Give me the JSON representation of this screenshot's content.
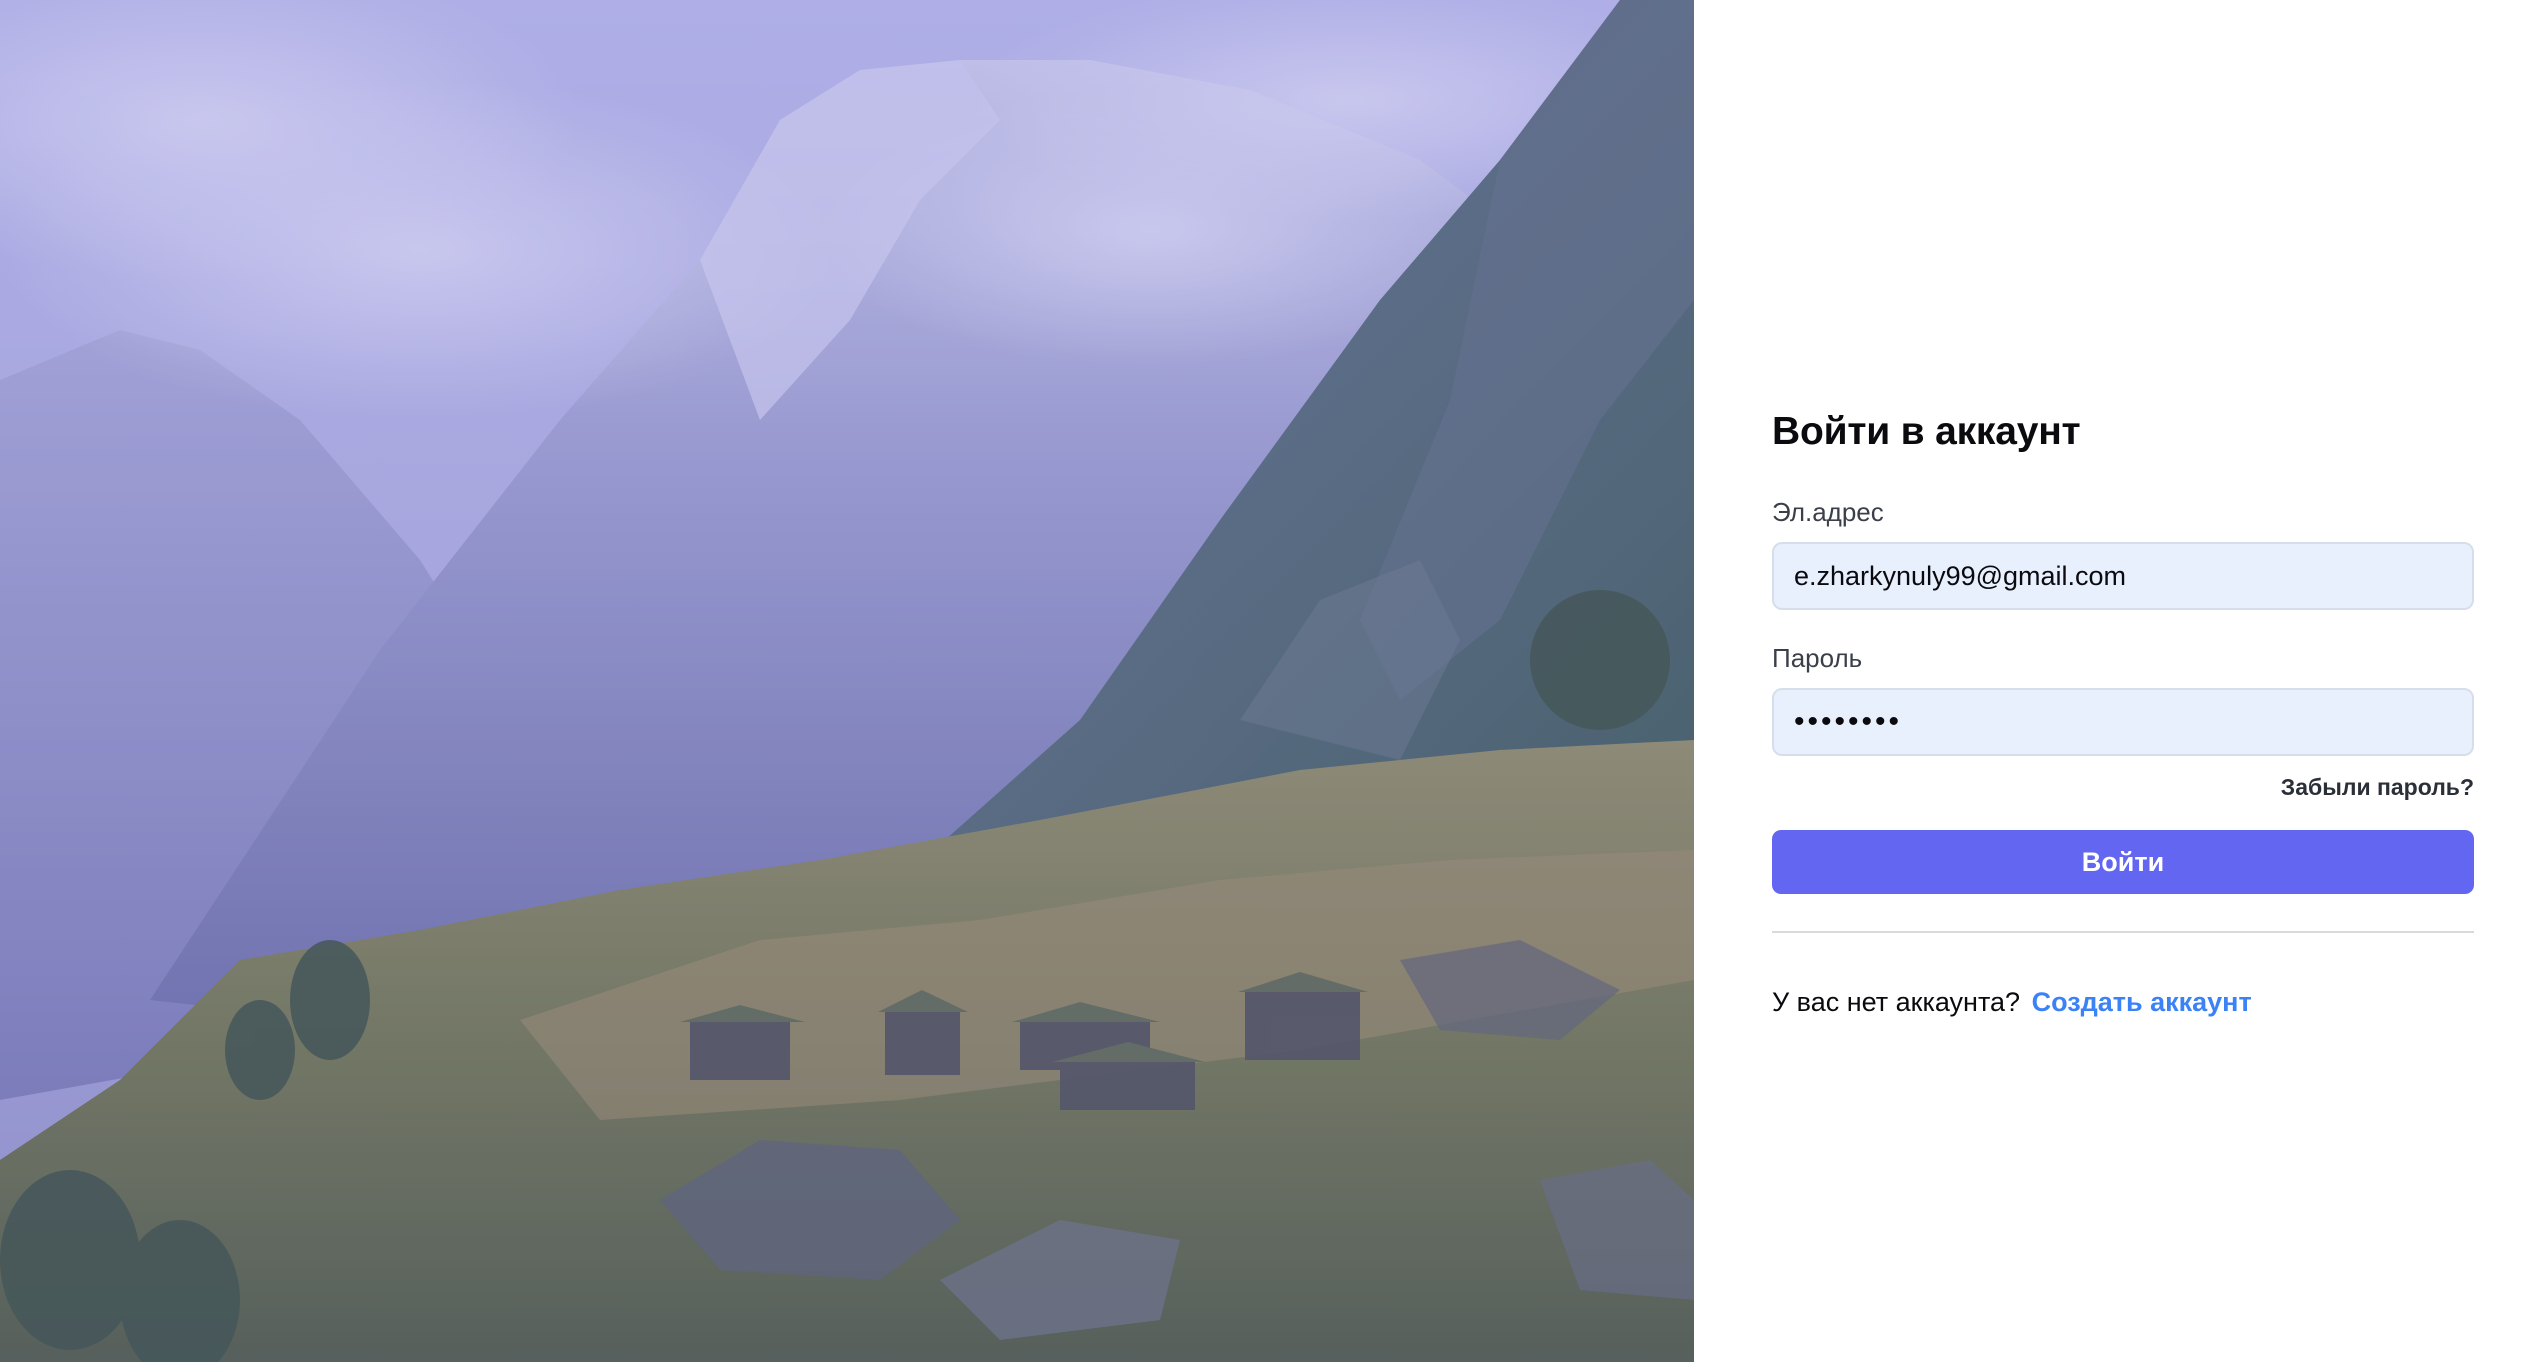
{
  "hero_image": {
    "alt": "",
    "tint": "#8f8fe0"
  },
  "login": {
    "title": "Войти в аккаунт",
    "email_label": "Эл.адрес",
    "email_value": "e.zharkynuly99@gmail.com",
    "password_label": "Пароль",
    "password_value": "12345678",
    "forgot_password": "Забыли пароль?",
    "submit_label": "Войти",
    "no_account_text": "У вас нет аккаунта?",
    "signup_link": "Создать аккаунт"
  },
  "colors": {
    "primary_button": "#6366f1",
    "link": "#3b82f6",
    "input_background": "#e8f0fe"
  }
}
